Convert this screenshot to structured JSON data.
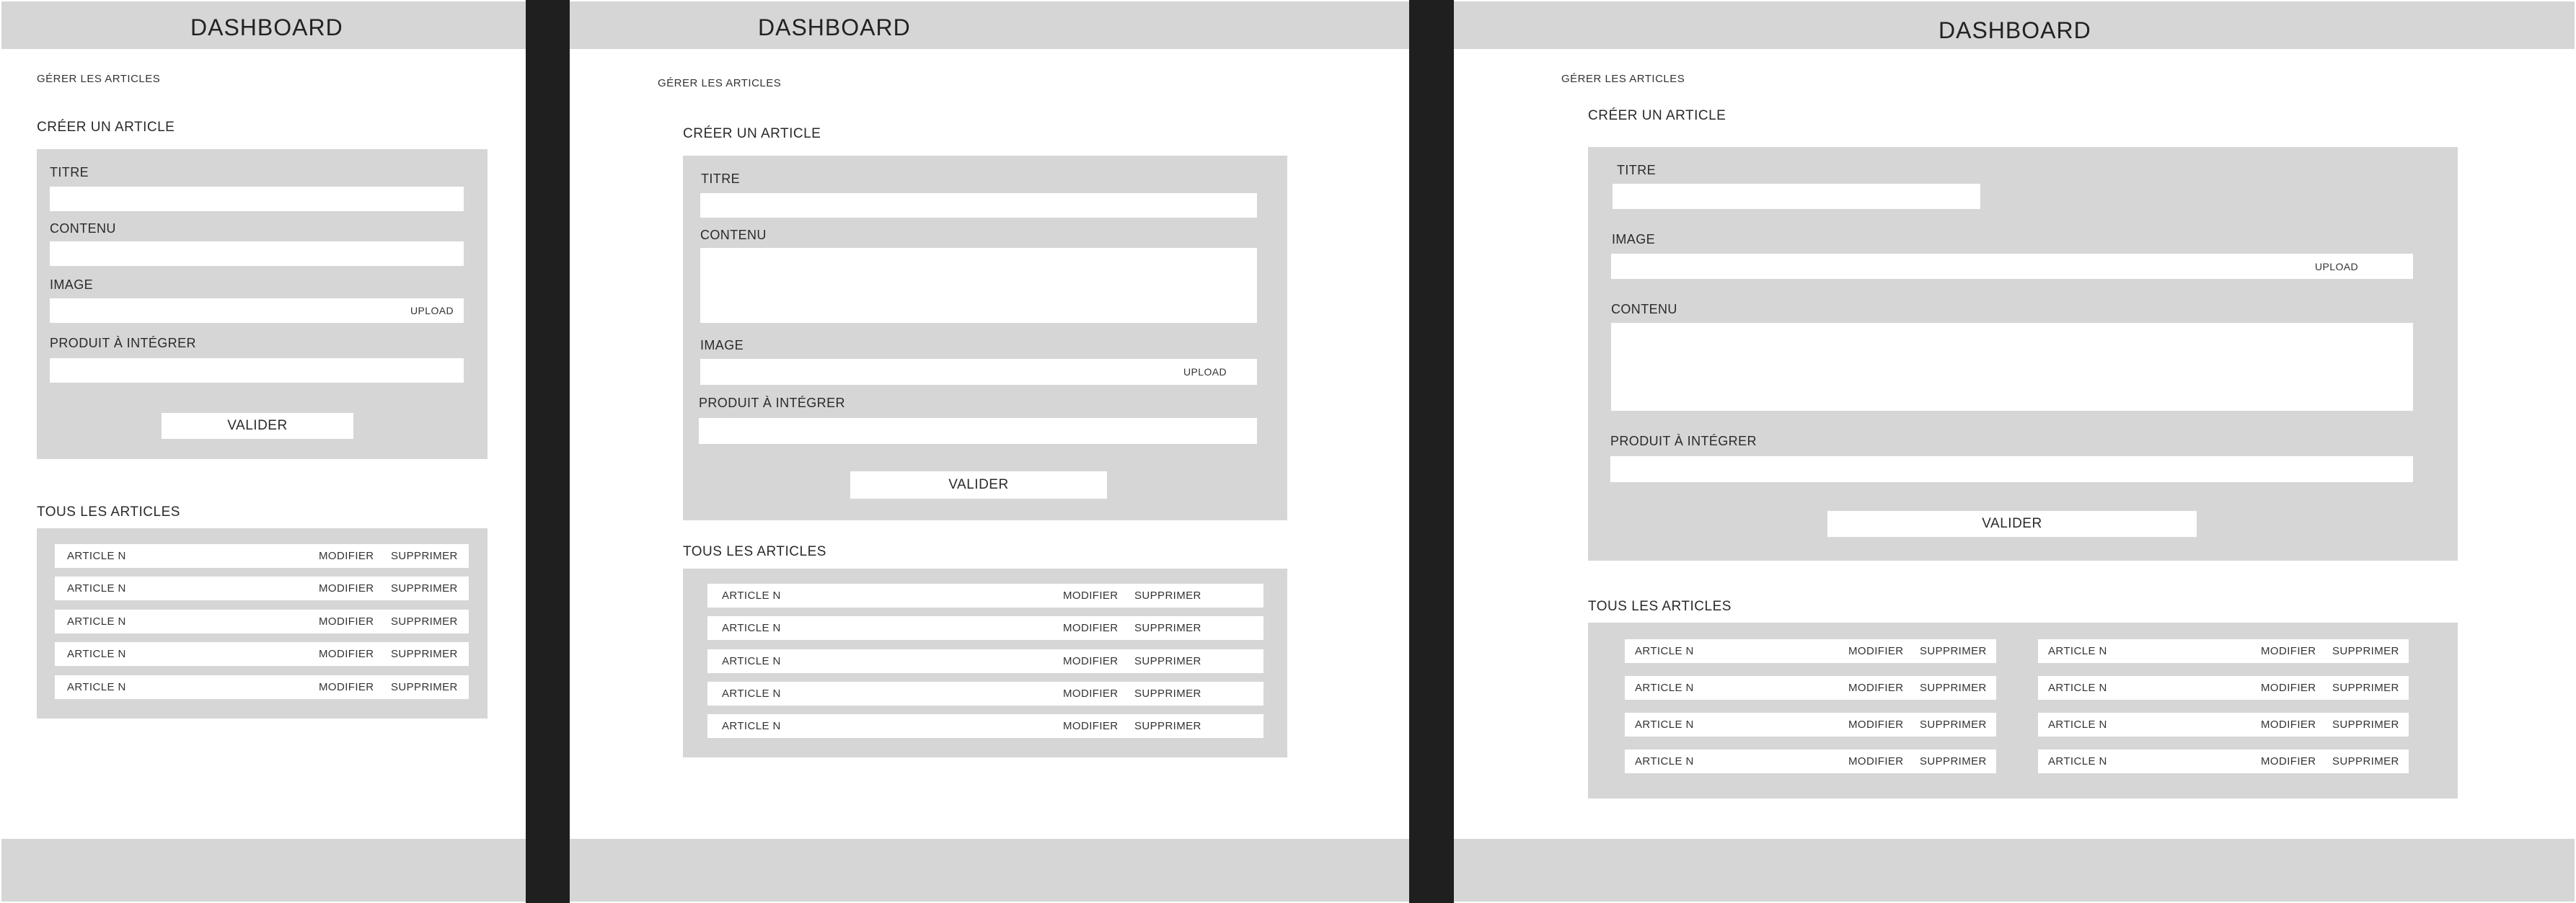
{
  "header": {
    "title": "DASHBOARD"
  },
  "nav": {
    "manage_articles": "GÉRER LES ARTICLES"
  },
  "create": {
    "title": "CRÉER UN ARTICLE",
    "fields": {
      "titre": "TITRE",
      "contenu": "CONTENU",
      "image": "IMAGE",
      "produit": "PRODUIT À INTÉGRER"
    },
    "upload_label": "UPLOAD",
    "submit_label": "VALIDER"
  },
  "list": {
    "title": "TOUS LES ARTICLES",
    "rows": [
      {
        "name": "ARTICLE N",
        "edit": "MODIFIER",
        "delete": "SUPPRIMER"
      },
      {
        "name": "ARTICLE N",
        "edit": "MODIFIER",
        "delete": "SUPPRIMER"
      },
      {
        "name": "ARTICLE N",
        "edit": "MODIFIER",
        "delete": "SUPPRIMER"
      },
      {
        "name": "ARTICLE N",
        "edit": "MODIFIER",
        "delete": "SUPPRIMER"
      },
      {
        "name": "ARTICLE N",
        "edit": "MODIFIER",
        "delete": "SUPPRIMER"
      },
      {
        "name": "ARTICLE N",
        "edit": "MODIFIER",
        "delete": "SUPPRIMER"
      },
      {
        "name": "ARTICLE N",
        "edit": "MODIFIER",
        "delete": "SUPPRIMER"
      },
      {
        "name": "ARTICLE N",
        "edit": "MODIFIER",
        "delete": "SUPPRIMER"
      }
    ]
  },
  "colors": {
    "panel_gray": "#d6d6d6",
    "separator": "#1f1f1f",
    "field_white": "#ffffff"
  }
}
